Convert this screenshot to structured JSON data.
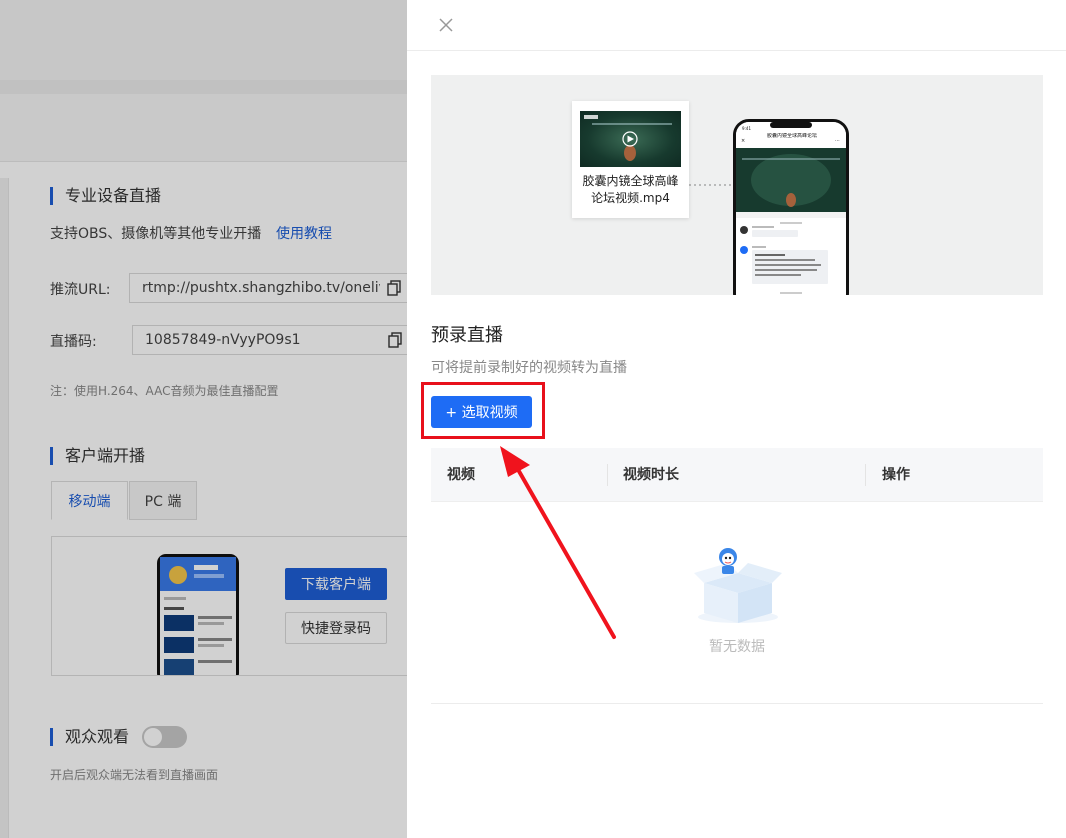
{
  "background": {
    "pro_device": {
      "title": "专业设备直播",
      "desc": "支持OBS、摄像机等其他专业开播",
      "tutorial_link": "使用教程",
      "push_url_label": "推流URL:",
      "push_url_value": "rtmp://pushtx.shangzhibo.tv/onelive",
      "stream_code_label": "直播码:",
      "stream_code_value": "10857849-nVyyPO9s1",
      "note": "注：使用H.264、AAC音频为最佳直播配置"
    },
    "client": {
      "title": "客户端开播",
      "tabs": [
        "移动端",
        "PC 端"
      ],
      "download_button": "下载客户端",
      "quick_login_button": "快捷登录码"
    },
    "audience": {
      "title": "观众观看",
      "toggle_on": false,
      "desc": "开启后观众端无法看到直播画面"
    }
  },
  "drawer": {
    "hero": {
      "video_card_name": "胶囊内镜全球高峰论坛视频.mp4",
      "phone_title": "胶囊内镜全球高峰论坛"
    },
    "title": "预录直播",
    "desc": "可将提前录制好的视频转为直播",
    "select_button": "+ 选取视频",
    "table": {
      "columns": [
        "视频",
        "视频时长",
        "操作"
      ],
      "empty_text": "暂无数据"
    }
  },
  "colors": {
    "primary": "#1e6cf5",
    "annotation_red": "#e8101b",
    "accent_bar": "#1e5fd6"
  },
  "icons": [
    "close-icon",
    "copy-icon",
    "play-icon",
    "empty-box-icon",
    "annotation-arrow-icon"
  ]
}
